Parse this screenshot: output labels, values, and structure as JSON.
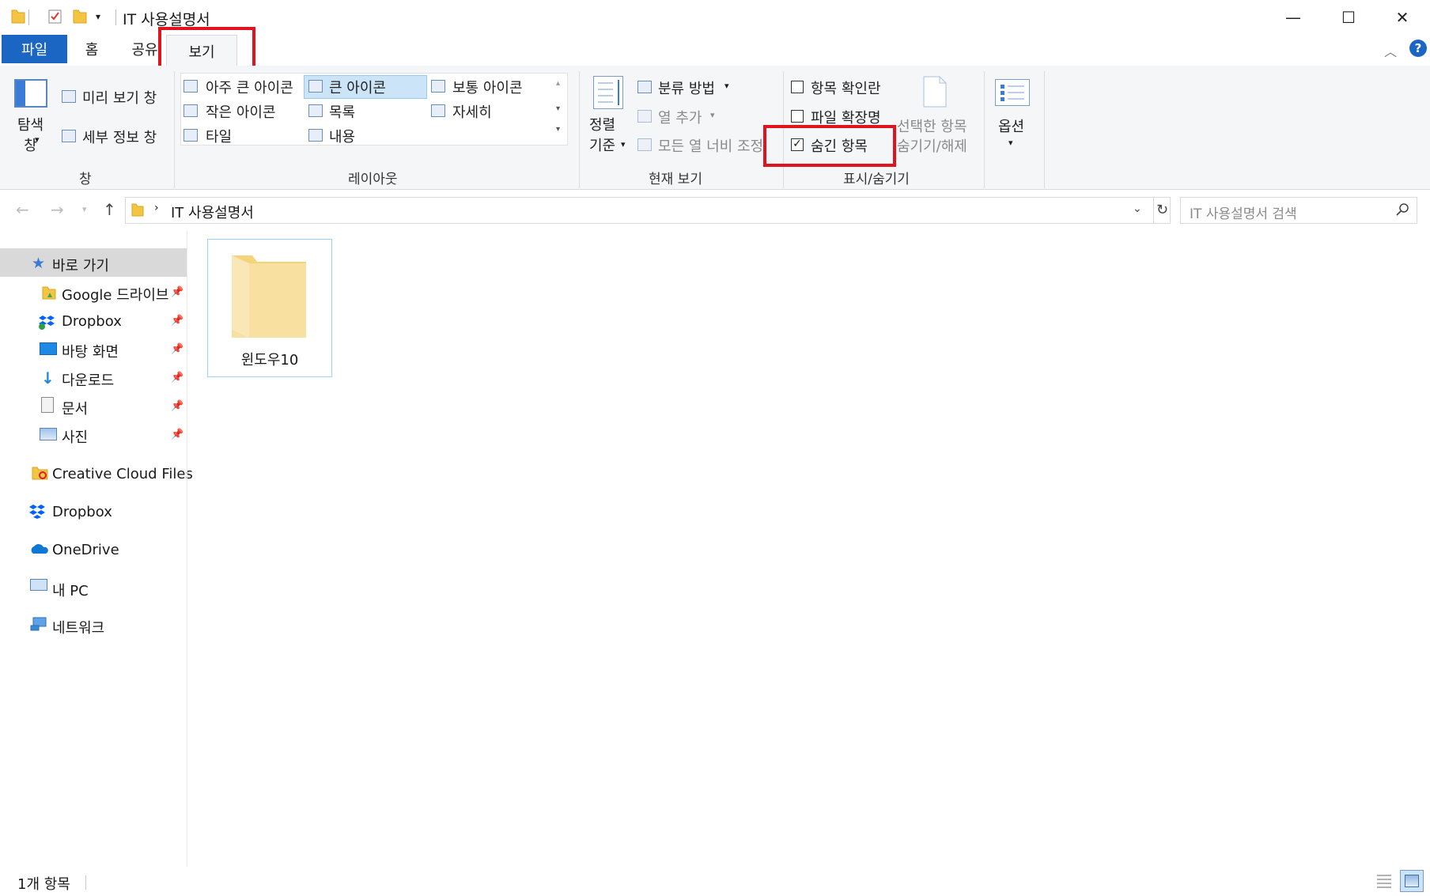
{
  "window": {
    "title": "IT 사용설명서",
    "minimize_glyph": "—",
    "maximize_glyph": "☐",
    "close_glyph": "✕"
  },
  "tabs": [
    {
      "label": "파일"
    },
    {
      "label": "홈"
    },
    {
      "label": "공유"
    },
    {
      "label": "보기"
    }
  ],
  "ribbon": {
    "pane": {
      "nav_pane": "탐색\n창",
      "preview_pane": "미리 보기 창",
      "details_pane": "세부 정보 창",
      "label": "창"
    },
    "layout": {
      "items": [
        "아주 큰 아이콘",
        "큰 아이콘",
        "보통 아이콘",
        "작은 아이콘",
        "목록",
        "자세히",
        "타일",
        "내용"
      ],
      "selected": "큰 아이콘",
      "label": "레이아웃"
    },
    "current_view": {
      "sort_by": "정렬\n기준",
      "group_by": "분류 방법",
      "add_columns": "열 추가",
      "size_all_columns": "모든 열 너비 조정",
      "label": "현재 보기"
    },
    "show_hide": {
      "item_checkboxes": {
        "label": "항목 확인란",
        "checked": false
      },
      "file_extensions": {
        "label": "파일 확장명",
        "checked": false
      },
      "hidden_items": {
        "label": "숨긴 항목",
        "checked": true
      },
      "hide_selected_line1": "선택한 항목",
      "hide_selected_line2": "숨기기/해제",
      "label": "표시/숨기기"
    },
    "options": {
      "label": "옵션"
    }
  },
  "address": {
    "path": "IT 사용설명서",
    "search_placeholder": "IT 사용설명서 검색"
  },
  "nav": {
    "quick_access": "바로 가기",
    "pinned": [
      "Google 드라이브",
      "Dropbox",
      "바탕 화면",
      "다운로드",
      "문서",
      "사진"
    ],
    "roots": [
      "Creative Cloud Files",
      "Dropbox",
      "OneDrive",
      "내 PC",
      "네트워크"
    ]
  },
  "content": {
    "items": [
      {
        "name": "윈도우10",
        "type": "folder"
      }
    ]
  },
  "status": {
    "count": "1개 항목"
  },
  "colors": {
    "accent": "#1a66c2",
    "highlight_box": "#e0141e",
    "folder": "#f8e0a0"
  }
}
